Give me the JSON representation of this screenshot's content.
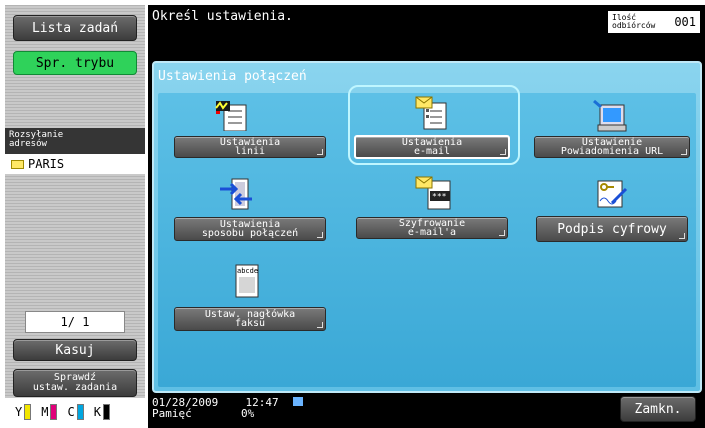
{
  "sidebar": {
    "job_list": "Lista zadań",
    "mode_check": "Spr. trybu",
    "address_label_1": "Rozsyłanie",
    "address_label_2": "adresów",
    "destination": "PARIS",
    "page_counter": "1/ 1",
    "delete": "Kasuj",
    "check_job_1": "Sprawdź",
    "check_job_2": "ustaw. zadania",
    "toners": [
      {
        "letter": "Y",
        "color": "#f2e600"
      },
      {
        "letter": "M",
        "color": "#e0007a"
      },
      {
        "letter": "C",
        "color": "#00a6e0"
      },
      {
        "letter": "K",
        "color": "#000000"
      }
    ]
  },
  "header": {
    "message": "Określ ustawienia.",
    "recipients_label": "Ilość odbiórców",
    "recipients_count": "001"
  },
  "panel": {
    "title": "Ustawienia połączeń",
    "tiles": [
      {
        "line1": "Ustawienia",
        "line2": "linii",
        "icon": "line-settings-icon"
      },
      {
        "line1": "Ustawienia",
        "line2": "e-mail",
        "icon": "email-settings-icon",
        "selected": true
      },
      {
        "line1": "Ustawienie",
        "line2": "Powiadomienia URL",
        "icon": "url-notification-icon"
      },
      {
        "line1": "Ustawienia",
        "line2": "sposobu połączeń",
        "icon": "connection-method-icon"
      },
      {
        "line1": "Szyfrowanie",
        "line2": "e-mail'a",
        "icon": "email-encryption-icon"
      },
      {
        "line1": "Podpis cyfrowy",
        "line2": "",
        "icon": "digital-signature-icon"
      },
      {
        "line1": "Ustaw. nagłówka",
        "line2": "faksu",
        "icon": "fax-header-icon"
      }
    ]
  },
  "status": {
    "date": "01/28/2009",
    "time": "12:47",
    "memory_label": "Pamięć",
    "memory_value": "0%"
  },
  "close_label": "Zamkn.",
  "accent_color": "#5fbfe4"
}
